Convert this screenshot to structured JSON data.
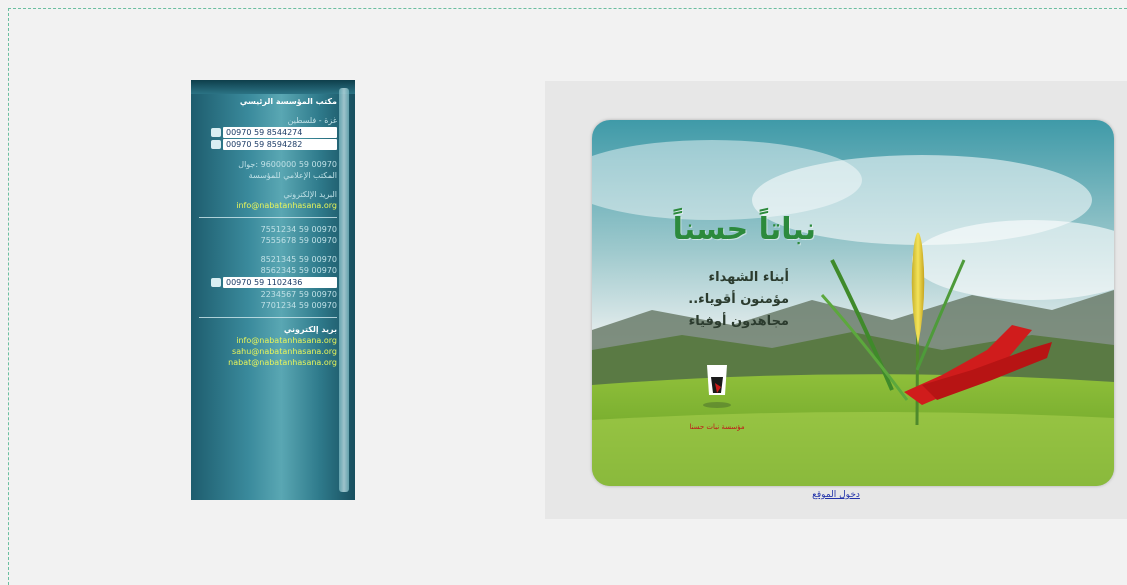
{
  "contact": {
    "lines": [
      {
        "text": "مكتب المؤسسة الرئيسي",
        "style": "head"
      },
      {
        "text": "",
        "style": "gap"
      },
      {
        "text": "غزة - فلسطين",
        "style": "dim"
      }
    ],
    "phones_top": [
      "00970 59 8544274",
      "00970 59 8594282"
    ],
    "mid_lines": [
      {
        "text": "",
        "style": "gap"
      },
      {
        "text": "00970 59 9600000 :جوال",
        "style": "dim"
      },
      {
        "text": "المكتب الإعلامي للمؤسسة",
        "style": "dim"
      },
      {
        "text": "",
        "style": "gap"
      },
      {
        "text": "البريد الإلكتروني",
        "style": "dim"
      },
      {
        "text": "info@nabatanhasana.org",
        "style": "yellow"
      }
    ],
    "mid_phones": [
      "00970 59 7551234",
      "00970 59 7555678",
      "",
      "00970 59 8521345",
      "00970 59 8562345"
    ],
    "phone_bottom": "00970 59 1102436",
    "bottom_phones": [
      "00970 59 2234567",
      "00970 59 7701234"
    ],
    "email_heading": "بريد إلكتروني",
    "emails": [
      "info@nabatanhasana.org",
      "sahu@nabatanhasana.org",
      "nabat@nabatanhasana.org"
    ]
  },
  "banner": {
    "title": "نباتاً حسناً",
    "line1": "أبناء الشهداء",
    "line2": "مؤمنون أقوياء..",
    "line3": "مجاهدون أوفياء",
    "logo_text": "مؤسسة نبات حسنا",
    "enter_link": "دخول الموقع"
  },
  "colors": {
    "panel_teal": "#2f7b8c",
    "title_green": "#2c8a3c",
    "link_blue": "#2233aa",
    "email_yellow": "#e9f55a"
  }
}
